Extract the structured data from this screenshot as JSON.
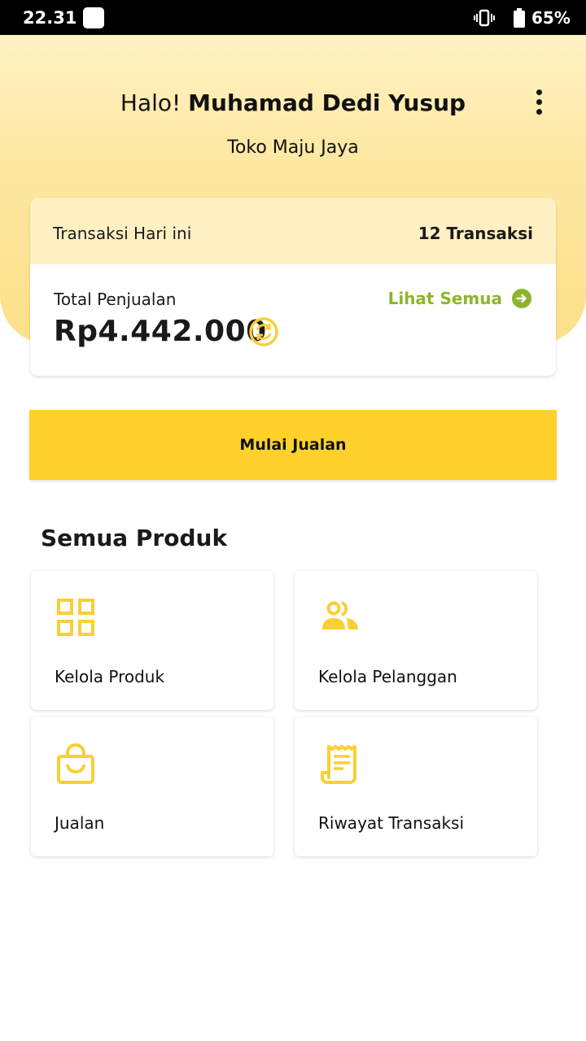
{
  "status_bar": {
    "time": "22.31",
    "battery": "65%"
  },
  "header": {
    "greeting_prefix": "Halo!",
    "user_name": "Muhamad Dedi Yusup",
    "store_name": "Toko Maju Jaya"
  },
  "summary": {
    "transactions_label": "Transaksi Hari ini",
    "transactions_count": "12 Transaksi",
    "total_label": "Total Penjualan",
    "total_value": "Rp4.442.000",
    "see_all_label": "Lihat Semua"
  },
  "cta": {
    "label": "Mulai Jualan"
  },
  "products": {
    "title": "Semua Produk",
    "items": [
      {
        "label": "Kelola Produk",
        "icon": "grid-icon"
      },
      {
        "label": "Kelola Pelanggan",
        "icon": "users-icon"
      },
      {
        "label": "Jualan",
        "icon": "shopping-bag-icon"
      },
      {
        "label": "Riwayat Transaksi",
        "icon": "receipt-icon"
      }
    ]
  },
  "colors": {
    "accent_yellow": "#ffd12a",
    "icon_yellow": "#f9cf35",
    "link_green": "#8db52b",
    "header_gradient_top": "#fff2c4",
    "header_gradient_bottom": "#fde088"
  }
}
